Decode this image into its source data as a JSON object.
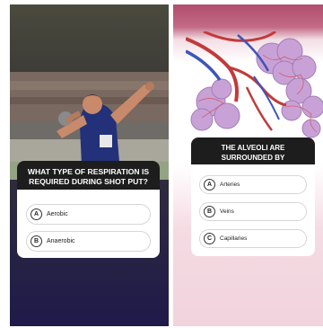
{
  "left_story": {
    "question": "WHAT TYPE OF RESPIRATION IS REQUIRED DURING SHOT PUT?",
    "options": [
      {
        "letter": "A",
        "label": "Aerobic"
      },
      {
        "letter": "B",
        "label": "Anaerobic"
      }
    ]
  },
  "right_story": {
    "question": "THE ALVEOLI ARE SURROUNDED BY",
    "options": [
      {
        "letter": "A",
        "label": "Arteries"
      },
      {
        "letter": "B",
        "label": "Veins"
      },
      {
        "letter": "C",
        "label": "Capillaries"
      }
    ]
  },
  "colors": {
    "left_background_bottom": "#1f1a4a",
    "right_background_top": "#b04e6d",
    "card_header": "#1d1d1d"
  }
}
